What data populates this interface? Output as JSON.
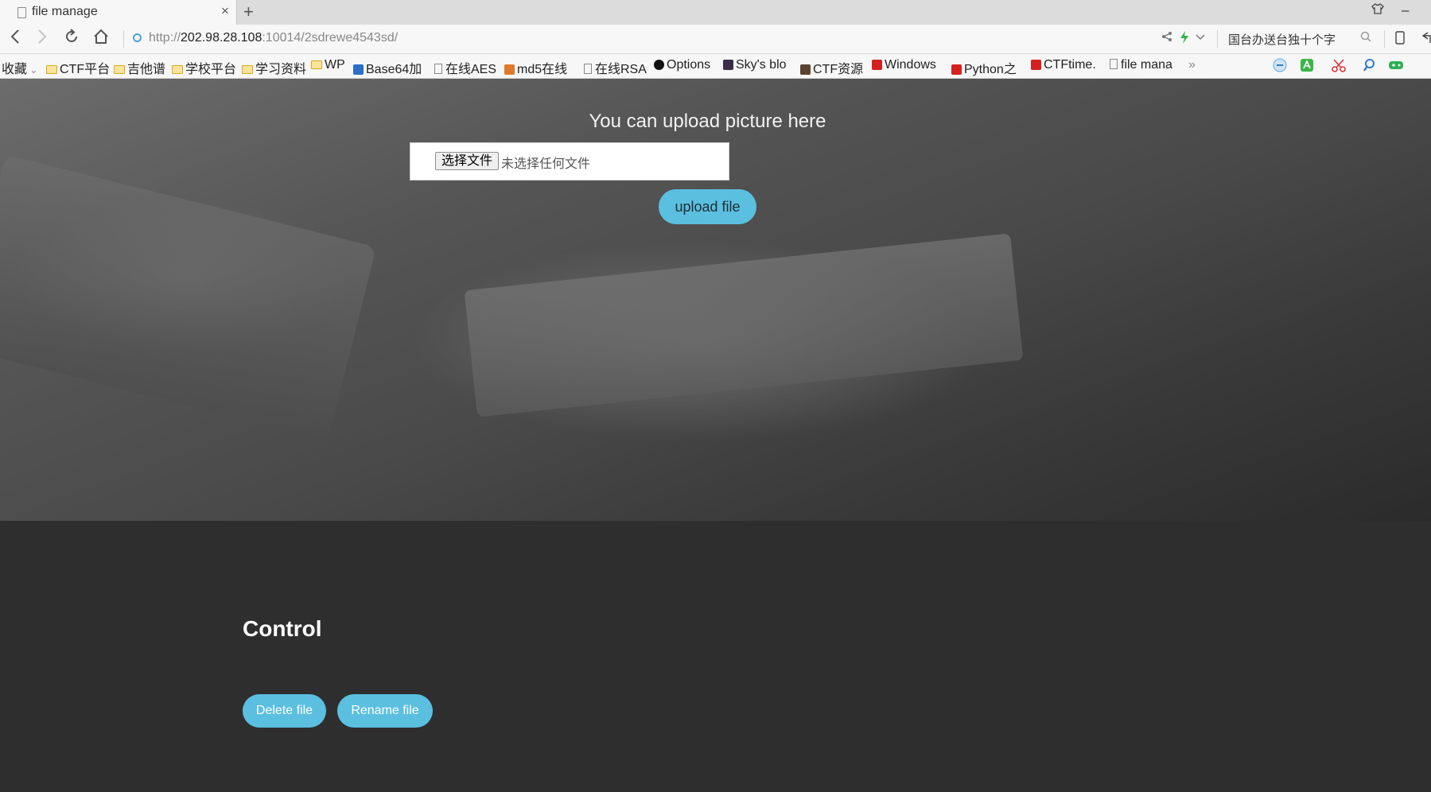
{
  "browser": {
    "tab_title": "file manage",
    "tab_close": "×",
    "new_tab": "+",
    "url_scheme": "http://",
    "url_host": "202.98.28.108",
    "url_rest": ":10014/2sdrewe4543sd/",
    "search_query": "国台办送台独十个字"
  },
  "bookmarks": [
    {
      "label": "收藏",
      "kind": "menu"
    },
    {
      "label": "CTF平台",
      "kind": "folder"
    },
    {
      "label": "吉他谱",
      "kind": "folder"
    },
    {
      "label": "学校平台",
      "kind": "folder"
    },
    {
      "label": "学习资料",
      "kind": "folder"
    },
    {
      "label": "WP",
      "kind": "folder"
    },
    {
      "label": "Base64加",
      "kind": "site"
    },
    {
      "label": "在线AES",
      "kind": "page"
    },
    {
      "label": "md5在线",
      "kind": "site"
    },
    {
      "label": "在线RSA",
      "kind": "page"
    },
    {
      "label": "Options",
      "kind": "github"
    },
    {
      "label": "Sky's blo",
      "kind": "site"
    },
    {
      "label": "CTF资源",
      "kind": "site"
    },
    {
      "label": "Windows",
      "kind": "red"
    },
    {
      "label": "Python之",
      "kind": "red"
    },
    {
      "label": "CTFtime.",
      "kind": "red"
    },
    {
      "label": "file mana",
      "kind": "page"
    },
    {
      "label": "»",
      "kind": "more"
    }
  ],
  "upload": {
    "heading": "You can upload picture here",
    "choose_button": "选择文件",
    "no_file_text": "未选择任何文件",
    "upload_button": "upload file"
  },
  "control": {
    "heading": "Control",
    "delete_button": "Delete file",
    "rename_button": "Rename file"
  },
  "colors": {
    "accent": "#5bbfe0",
    "page_bg": "#2e2e2e"
  }
}
